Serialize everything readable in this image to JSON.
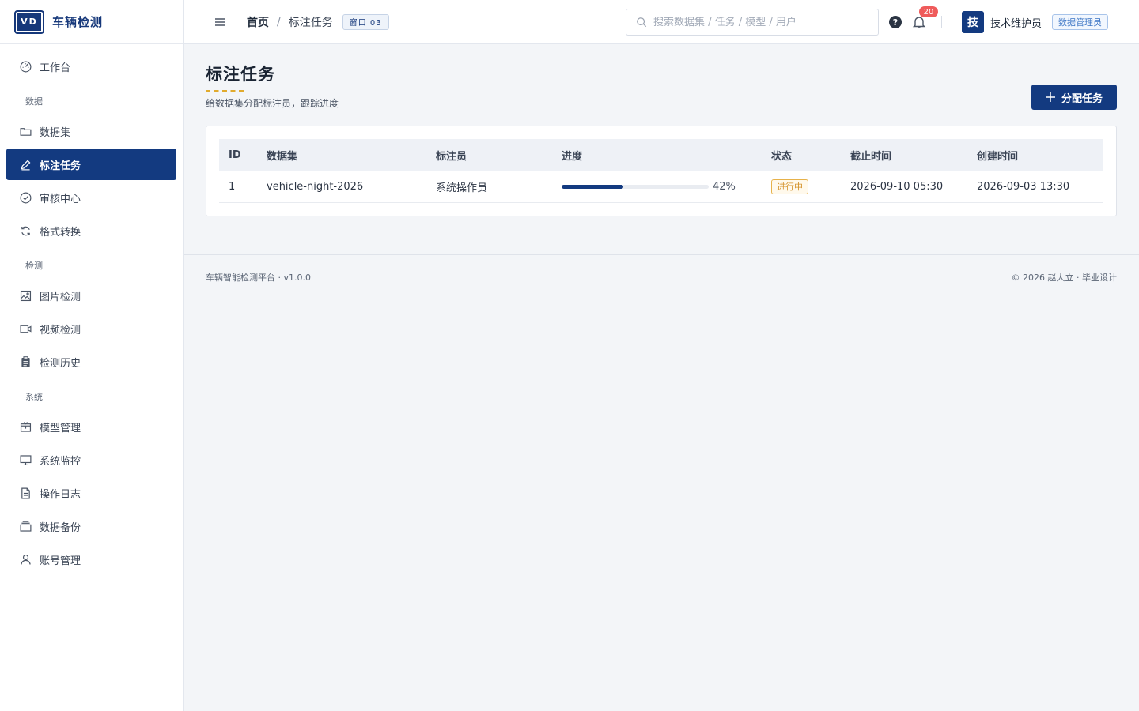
{
  "brand": {
    "logo_text": "VD",
    "name": "车辆检测"
  },
  "sidebar": {
    "items": [
      {
        "label": "工作台",
        "icon": "dashboard-icon"
      },
      {
        "group": "数据"
      },
      {
        "label": "数据集",
        "icon": "folder-icon"
      },
      {
        "label": "标注任务",
        "icon": "pen-icon",
        "active": true
      },
      {
        "label": "审核中心",
        "icon": "check-circle-icon"
      },
      {
        "label": "格式转换",
        "icon": "refresh-icon"
      },
      {
        "group": "检测"
      },
      {
        "label": "图片检测",
        "icon": "image-icon"
      },
      {
        "label": "视频检测",
        "icon": "video-icon"
      },
      {
        "label": "检测历史",
        "icon": "clipboard-icon"
      },
      {
        "group": "系统"
      },
      {
        "label": "模型管理",
        "icon": "package-icon"
      },
      {
        "label": "系统监控",
        "icon": "monitor-icon"
      },
      {
        "label": "操作日志",
        "icon": "document-icon"
      },
      {
        "label": "数据备份",
        "icon": "archive-icon"
      },
      {
        "label": "账号管理",
        "icon": "user-icon"
      }
    ]
  },
  "topbar": {
    "breadcrumb": {
      "home": "首页",
      "separator": "/",
      "current": "标注任务"
    },
    "window_badge": "窗口 03",
    "search_placeholder": "搜索数据集 / 任务 / 模型 / 用户",
    "notification_count": "20",
    "avatar_text": "技",
    "user_name": "技术维护员",
    "role": "数据管理员"
  },
  "page": {
    "title": "标注任务",
    "subtitle": "给数据集分配标注员，跟踪进度",
    "assign_button": "分配任务"
  },
  "table": {
    "headers": {
      "id": "ID",
      "dataset": "数据集",
      "annotator": "标注员",
      "progress": "进度",
      "status": "状态",
      "deadline": "截止时间",
      "created": "创建时间"
    },
    "rows": [
      {
        "id": "1",
        "dataset": "vehicle-night-2026",
        "annotator": "系统操作员",
        "progress": 42,
        "progress_label": "42%",
        "status": "进行中",
        "deadline": "2026-09-10 05:30",
        "created": "2026-09-03 13:30"
      }
    ]
  },
  "footer": {
    "left": "车辆智能检测平台 · v1.0.0",
    "right": "© 2026 赵大立 · 毕业设计"
  },
  "colors": {
    "primary": "#133a80",
    "accent_underline": "#e1ab2e",
    "status_in_progress": "#d4922a",
    "badge_red": "#ef5b5b"
  }
}
